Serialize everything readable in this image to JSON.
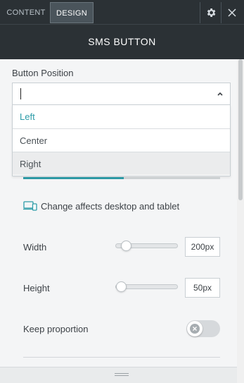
{
  "tabs": [
    {
      "label": "CONTENT",
      "active": false
    },
    {
      "label": "DESIGN",
      "active": true
    }
  ],
  "header": {
    "title": "SMS BUTTON",
    "settings_icon": "gear-icon",
    "close_icon": "close-icon"
  },
  "button_position": {
    "label": "Button Position",
    "value": "",
    "options": [
      {
        "label": "Left",
        "selected": true
      },
      {
        "label": "Center",
        "selected": false
      },
      {
        "label": "Right",
        "hovered": true
      }
    ]
  },
  "note": {
    "icon": "devices-icon",
    "text": "Change affects desktop and tablet"
  },
  "width": {
    "label": "Width",
    "value": "200px",
    "slider_fraction": 0.1
  },
  "height": {
    "label": "Height",
    "value": "50px",
    "slider_fraction": 0.0
  },
  "keep_proportion": {
    "label": "Keep proportion",
    "enabled": false
  },
  "colors": {
    "header": "#2b3135",
    "accent": "#2d9ca8",
    "body": "#f4f5f6"
  }
}
